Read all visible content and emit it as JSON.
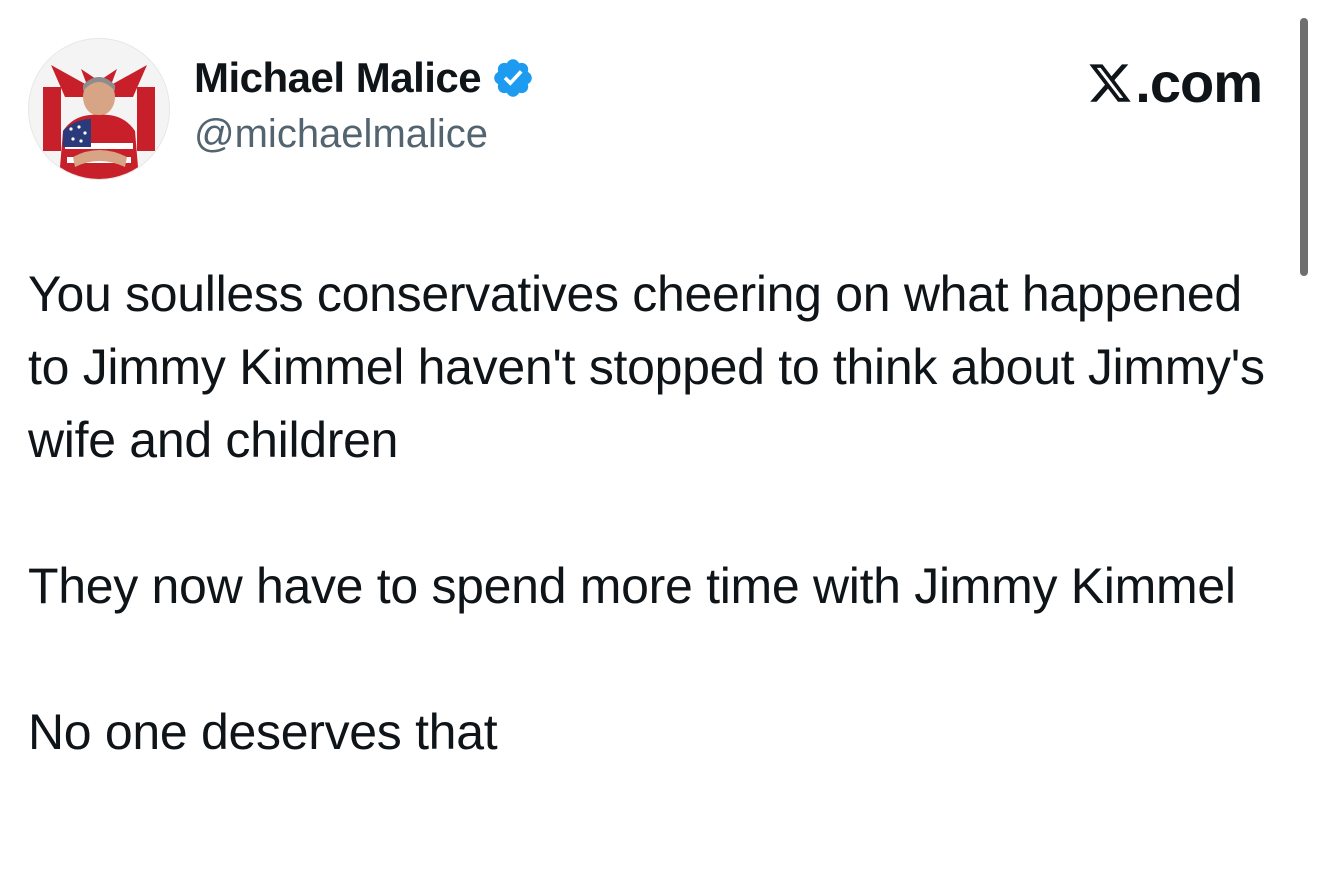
{
  "author": {
    "display_name": "Michael Malice",
    "handle": "@michaelmalice",
    "verified": true,
    "verified_icon": "verified-badge-icon",
    "badge_color": "#1d9bf0",
    "avatar_icon": "profile-avatar"
  },
  "site": {
    "logo_suffix": ".com",
    "logo_icon": "x-logo-icon"
  },
  "tweet": {
    "paragraphs": [
      "You soulless conservatives cheering on what happened to Jimmy Kimmel haven't stopped to think about Jimmy's wife and children",
      "They now have to spend more time with Jimmy Kimmel",
      "No one deserves that"
    ]
  },
  "colors": {
    "text": "#0f1419",
    "secondary_text": "#536471",
    "background": "#ffffff"
  }
}
